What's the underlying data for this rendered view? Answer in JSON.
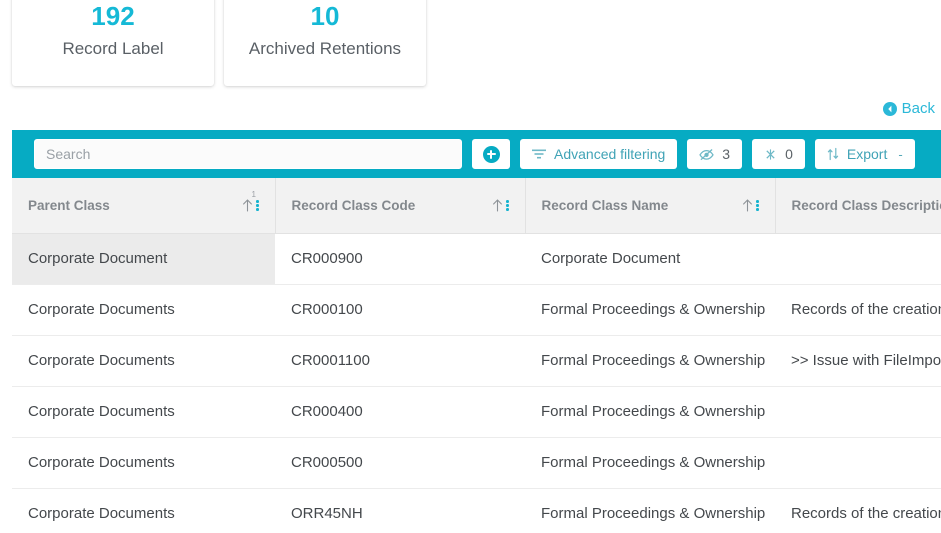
{
  "stats": [
    {
      "value": "192",
      "label": "Record Label"
    },
    {
      "value": "10",
      "label": "Archived Retentions"
    }
  ],
  "back": {
    "label": "Back",
    "icon": "circle-chevron-left-icon"
  },
  "toolbar": {
    "search_placeholder": "Search",
    "search_value": "",
    "add_icon": "plus-circle-icon",
    "advanced_filtering_label": "Advanced filtering",
    "advanced_filtering_icon": "filter-icon",
    "hidden_columns_icon": "eye-slash-icon",
    "hidden_columns_count": "3",
    "pinned_icon": "pin-off-icon",
    "pinned_count": "0",
    "export_label": "Export",
    "export_icon": "sort-arrows-icon",
    "export_caret": "-"
  },
  "table": {
    "columns": [
      {
        "label": "Parent Class",
        "sort_order": "1",
        "sort_dir": "asc"
      },
      {
        "label": "Record Class Code",
        "sort_order": "",
        "sort_dir": "asc"
      },
      {
        "label": "Record Class Name",
        "sort_order": "",
        "sort_dir": "asc"
      },
      {
        "label": "Record Class Description",
        "sort_order": "",
        "sort_dir": "asc"
      }
    ],
    "rows": [
      {
        "parent_class": "Corporate Document",
        "record_class_code": "CR000900",
        "record_class_name": "Corporate Document",
        "record_class_description": "",
        "selected": true
      },
      {
        "parent_class": "Corporate Documents",
        "record_class_code": "CR000100",
        "record_class_name": "Formal Proceedings & Ownership",
        "record_class_description": "Records of the creation a",
        "selected": false
      },
      {
        "parent_class": "Corporate Documents",
        "record_class_code": "CR0001100",
        "record_class_name": "Formal Proceedings & Ownership",
        "record_class_description": ">> Issue with FileImport -",
        "selected": false
      },
      {
        "parent_class": "Corporate Documents",
        "record_class_code": "CR000400",
        "record_class_name": "Formal Proceedings & Ownership",
        "record_class_description": "",
        "selected": false
      },
      {
        "parent_class": "Corporate Documents",
        "record_class_code": "CR000500",
        "record_class_name": "Formal Proceedings & Ownership",
        "record_class_description": "",
        "selected": false
      },
      {
        "parent_class": "Corporate Documents",
        "record_class_code": "ORR45NH",
        "record_class_name": "Formal Proceedings & Ownership",
        "record_class_description": "Records of the creation a",
        "selected": false
      }
    ]
  },
  "colors": {
    "accent": "#06abc3",
    "stat_value": "#15b9d6",
    "link": "#2bb8d8",
    "header_bg": "#f2f2f2",
    "row_selected_bg": "#ebebeb"
  }
}
